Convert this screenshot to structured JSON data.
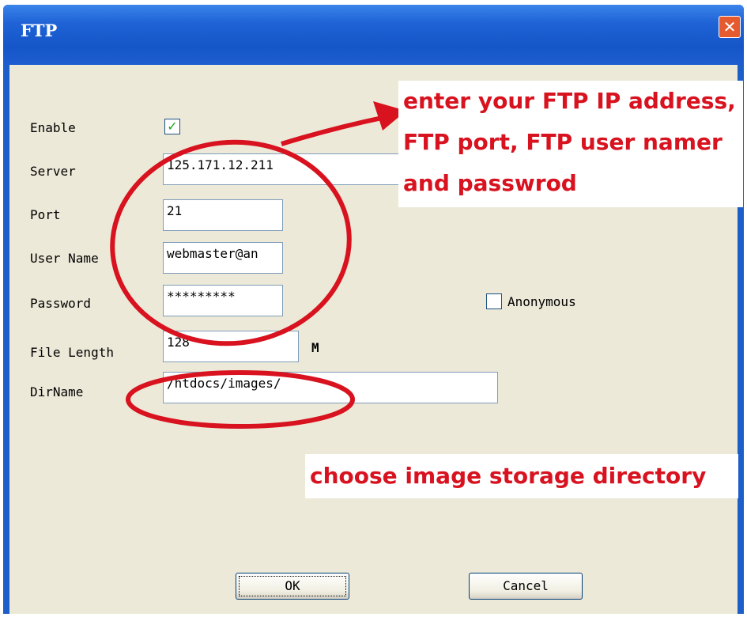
{
  "window": {
    "title": "FTP",
    "close_glyph": "✕"
  },
  "form": {
    "enable_label": "Enable",
    "enable_checked": true,
    "server_label": "Server",
    "server_value": "125.171.12.211",
    "port_label": "Port",
    "port_value": "21",
    "username_label": "User Name",
    "username_value": "webmaster@an",
    "password_label": "Password",
    "password_value": "*********",
    "anonymous_label": "Anonymous",
    "anonymous_checked": false,
    "file_length_label": "File Length",
    "file_length_value": "128",
    "file_length_unit": "M",
    "dirname_label": "DirName",
    "dirname_value": "/htdocs/images/"
  },
  "buttons": {
    "ok": "OK",
    "cancel": "Cancel"
  },
  "annotations": {
    "note1_lines": [
      "enter your FTP IP address,",
      "FTP port, FTP user namer",
      "and passwrod"
    ],
    "note2": "choose image storage directory",
    "color": "#d8121f"
  }
}
